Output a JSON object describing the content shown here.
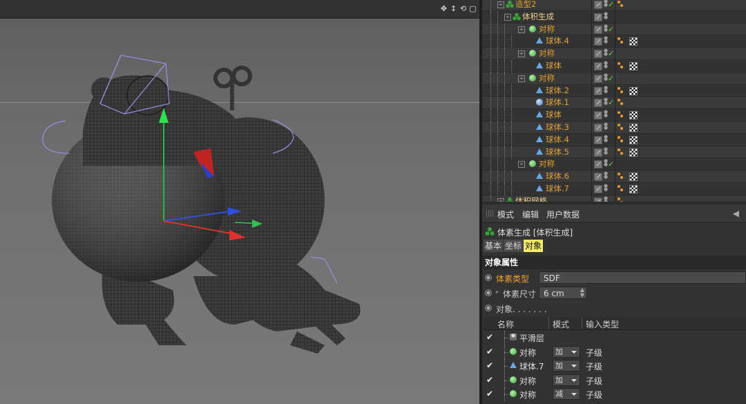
{
  "viewport": {
    "icons": [
      "move-view-icon",
      "zoom-view-icon",
      "rotate-view-icon",
      "maximize-view-icon"
    ]
  },
  "object_manager": {
    "rows": [
      {
        "name": "造型2",
        "indent": 0,
        "icon": "vol",
        "color": "orange",
        "check": true,
        "tag": "orange"
      },
      {
        "name": "体积生成",
        "indent": 1,
        "icon": "vol",
        "color": "white",
        "check": false,
        "tag": ""
      },
      {
        "name": "对称",
        "indent": 2,
        "icon": "sym",
        "color": "orange",
        "check": true,
        "tag": ""
      },
      {
        "name": "球体.4",
        "indent": 3,
        "icon": "sphereobj",
        "color": "orange",
        "check": false,
        "tag": "both"
      },
      {
        "name": "对称",
        "indent": 2,
        "icon": "sym",
        "color": "orange",
        "check": true,
        "tag": ""
      },
      {
        "name": "球体",
        "indent": 3,
        "icon": "sphereobj",
        "color": "orange",
        "check": false,
        "tag": "both"
      },
      {
        "name": "对称",
        "indent": 2,
        "icon": "sym",
        "color": "orange",
        "check": true,
        "tag": ""
      },
      {
        "name": "球体.2",
        "indent": 3,
        "icon": "sphereobj",
        "color": "orange",
        "check": false,
        "tag": "both"
      },
      {
        "name": "球体.1",
        "indent": 3,
        "icon": "sphere",
        "color": "orange",
        "check": true,
        "tag": "orange"
      },
      {
        "name": "球体",
        "indent": 3,
        "icon": "sphereobj",
        "color": "orange",
        "check": false,
        "tag": "both"
      },
      {
        "name": "球体.3",
        "indent": 3,
        "icon": "sphereobj",
        "color": "orange",
        "check": false,
        "tag": "both"
      },
      {
        "name": "球体.4",
        "indent": 3,
        "icon": "sphereobj",
        "color": "orange",
        "check": false,
        "tag": "both"
      },
      {
        "name": "球体.5",
        "indent": 3,
        "icon": "sphereobj",
        "color": "orange",
        "check": false,
        "tag": "both"
      },
      {
        "name": "对称",
        "indent": 2,
        "icon": "sym",
        "color": "orange",
        "check": true,
        "tag": ""
      },
      {
        "name": "球体.6",
        "indent": 3,
        "icon": "sphereobj",
        "color": "orange",
        "check": false,
        "tag": "both"
      },
      {
        "name": "球体.7",
        "indent": 3,
        "icon": "sphereobj",
        "color": "orange",
        "check": false,
        "tag": "both"
      },
      {
        "name": "体积网格",
        "indent": 0,
        "icon": "vol",
        "color": "white",
        "check": false,
        "tag": "orange"
      }
    ]
  },
  "attribute_manager": {
    "menu": {
      "mode": "模式",
      "edit": "编辑",
      "user_data": "用户数据"
    },
    "title": "体素生成 [体积生成]",
    "tabs": [
      {
        "label": "基本",
        "active": false
      },
      {
        "label": "坐标",
        "active": false
      },
      {
        "label": "对象",
        "active": true
      }
    ],
    "section": "对象属性",
    "voxel_type": {
      "label": "体素类型",
      "value": "SDF"
    },
    "voxel_size": {
      "label": "体素尺寸",
      "value": "6 cm"
    },
    "objects_label": "对象. . . . . . .",
    "table": {
      "headers": {
        "name": "名称",
        "mode": "模式",
        "input_type": "输入类型"
      },
      "rows": [
        {
          "checked": true,
          "name": "平滑层",
          "icon": "layer",
          "mode": "",
          "input": ""
        },
        {
          "checked": true,
          "name": "对称",
          "icon": "sym",
          "mode": "加",
          "input": "子级"
        },
        {
          "checked": true,
          "name": "球体.7",
          "icon": "sphereobj",
          "mode": "加",
          "input": "子级"
        },
        {
          "checked": true,
          "name": "对称",
          "icon": "sym",
          "mode": "加",
          "input": "子级"
        },
        {
          "checked": true,
          "name": "对称",
          "icon": "sym",
          "mode": "减",
          "input": "子级"
        }
      ]
    }
  },
  "colors": {
    "accent_tab": "#f2e86a",
    "object_name": "#e0a030",
    "check": "#6fcf3f"
  }
}
